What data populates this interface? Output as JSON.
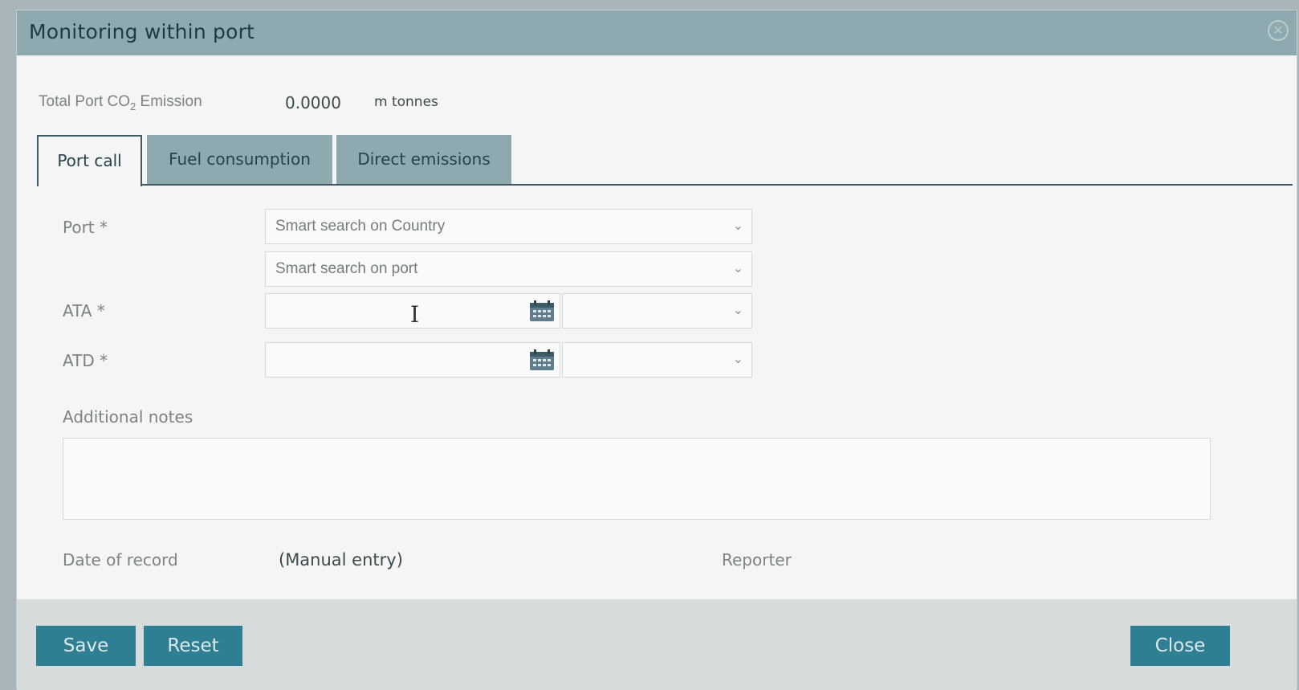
{
  "dialog": {
    "title": "Monitoring within port"
  },
  "summary": {
    "label_pre": "Total Port CO",
    "label_sub": "2",
    "label_post": " Emission",
    "value": "0.0000",
    "unit": "m tonnes"
  },
  "tabs": [
    {
      "label": "Port call",
      "active": true
    },
    {
      "label": "Fuel consumption",
      "active": false
    },
    {
      "label": "Direct emissions",
      "active": false
    }
  ],
  "form": {
    "port_label": "Port *",
    "country_placeholder": "Smart search on Country",
    "port_placeholder": "Smart search on port",
    "ata_label": "ATA *",
    "atd_label": "ATD *",
    "notes_label": "Additional notes",
    "date_of_record_label": "Date of record",
    "date_of_record_value": "(Manual entry)",
    "reporter_label": "Reporter"
  },
  "buttons": {
    "save": "Save",
    "reset": "Reset",
    "close": "Close"
  },
  "icons": {
    "close": "close-circle-icon",
    "calendar": "calendar-icon",
    "chevron": "chevron-down-icon"
  },
  "colors": {
    "titlebar": "#8eaab0",
    "button": "#2e7f93",
    "tab_inactive": "#8eaab0"
  }
}
